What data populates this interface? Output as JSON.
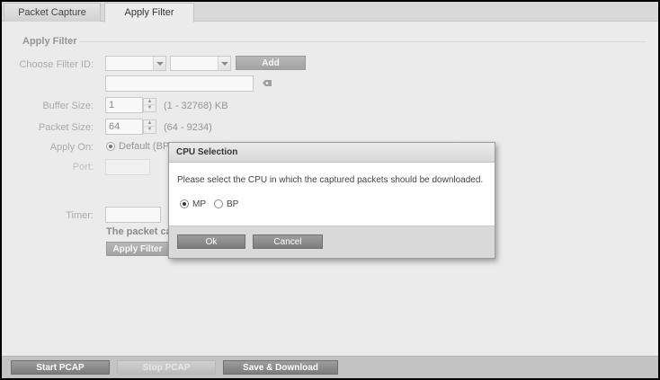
{
  "tabs": [
    {
      "label": "Packet Capture",
      "active": false
    },
    {
      "label": "Apply Filter",
      "active": true
    }
  ],
  "section": {
    "title": "Apply Filter"
  },
  "filter": {
    "choose_label": "Choose Filter ID:",
    "dropdown1_value": "",
    "dropdown2_value": "",
    "add_label": "Add",
    "text_value": ""
  },
  "buffer": {
    "label": "Buffer Size:",
    "value": "1",
    "range": "(1 - 32768) KB"
  },
  "packet": {
    "label": "Packet Size:",
    "value": "64",
    "range": "(64 - 9234)"
  },
  "apply_on": {
    "label": "Apply On:",
    "option_default": "Default (BP"
  },
  "port": {
    "label": "Port:",
    "value": ""
  },
  "timer": {
    "label": "Timer:",
    "value": "",
    "note": "The packet cap"
  },
  "apply_filter_button": "Apply Filter",
  "footer": {
    "start": "Start PCAP",
    "stop": "Stop PCAP",
    "save": "Save & Download"
  },
  "dialog": {
    "title": "CPU Selection",
    "message": "Please select the CPU in which the captured packets should be downloaded.",
    "options": [
      {
        "label": "MP",
        "selected": true
      },
      {
        "label": "BP",
        "selected": false
      }
    ],
    "ok": "Ok",
    "cancel": "Cancel"
  }
}
